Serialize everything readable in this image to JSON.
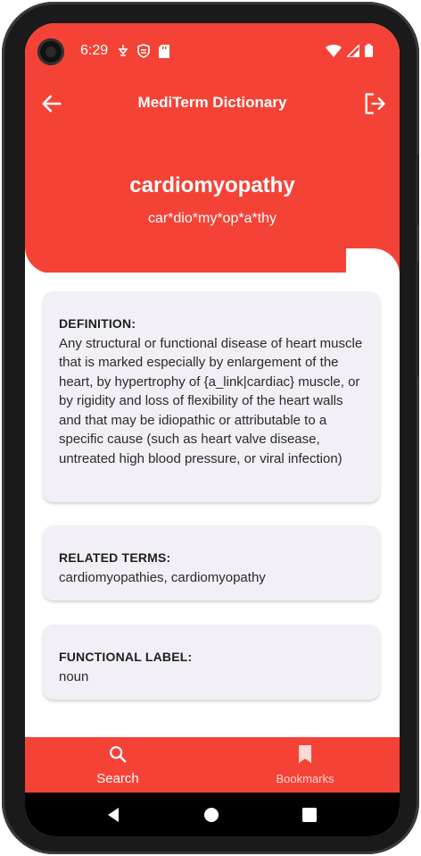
{
  "status_bar": {
    "time": "6:29"
  },
  "app_bar": {
    "title": "MediTerm Dictionary"
  },
  "entry": {
    "word": "cardiomyopathy",
    "syllables": "car*dio*my*op*a*thy"
  },
  "cards": {
    "definition": {
      "label": "DEFINITION:",
      "value": "Any structural or functional disease of heart muscle that is marked especially by enlargement of the heart, by hypertrophy of {a_link|cardiac} muscle, or by rigidity and loss of flexibility of the heart walls and that may be idiopathic or attributable to a specific cause (such as heart valve disease, untreated high blood pressure, or viral infection)"
    },
    "related": {
      "label": "RELATED TERMS:",
      "value": "cardiomyopathies, cardiomyopathy"
    },
    "functional": {
      "label": "FUNCTIONAL LABEL:",
      "value": "noun"
    }
  },
  "bottom_nav": {
    "search_label": "Search",
    "bookmarks_label": "Bookmarks"
  },
  "colors": {
    "primary": "#f44336",
    "card_bg": "#f3eff6"
  }
}
